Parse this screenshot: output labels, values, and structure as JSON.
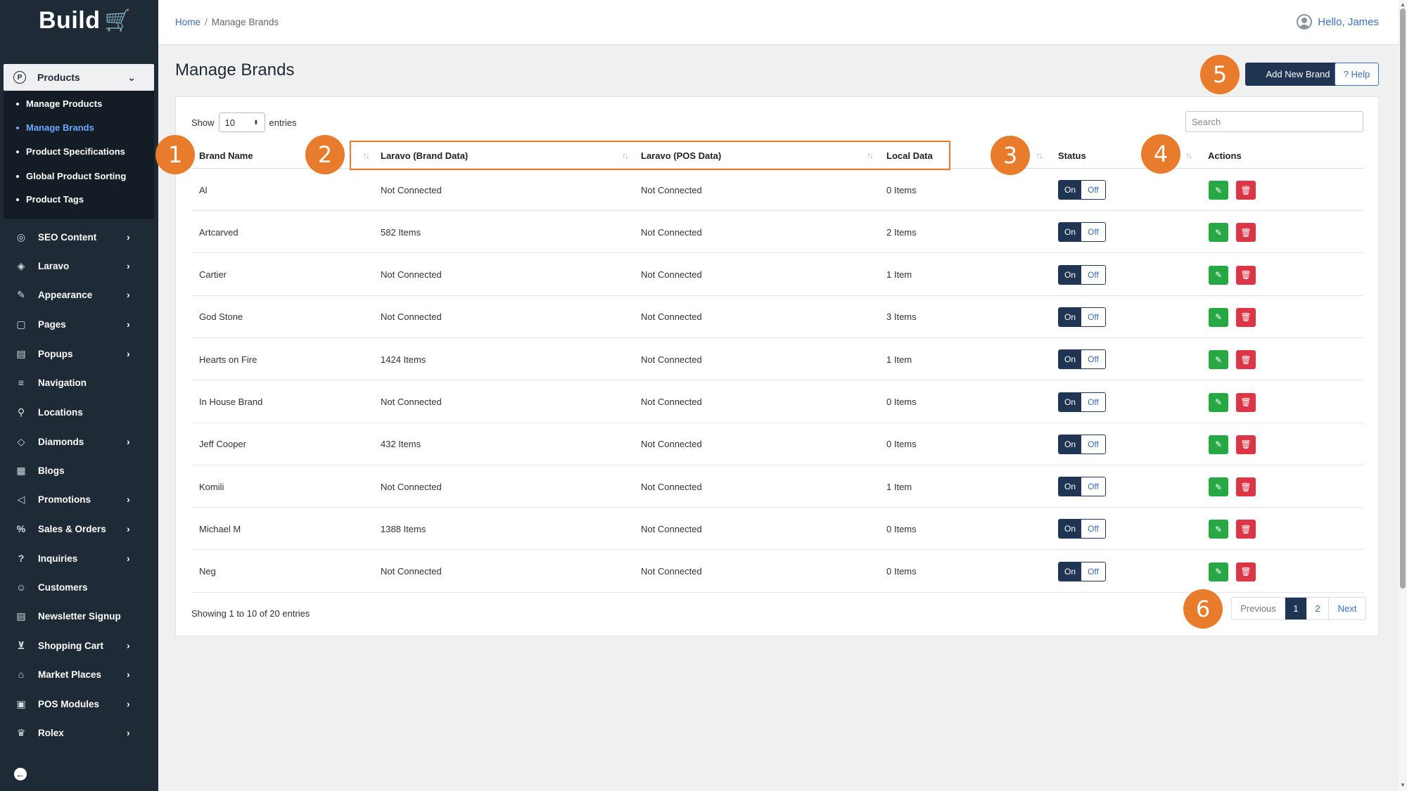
{
  "app": {
    "logo_text": "Build"
  },
  "sidebar": {
    "products": {
      "label": "Products",
      "subitems": [
        {
          "label": "Manage Products",
          "active": false
        },
        {
          "label": "Manage Brands",
          "active": true
        },
        {
          "label": "Product Specifications",
          "active": false
        },
        {
          "label": "Global Product Sorting",
          "active": false
        },
        {
          "label": "Product Tags",
          "active": false
        }
      ]
    },
    "items": [
      {
        "label": "SEO Content",
        "icon": "seo-icon",
        "chevron": true
      },
      {
        "label": "Laravo",
        "icon": "layers-icon",
        "chevron": true
      },
      {
        "label": "Appearance",
        "icon": "brush-icon",
        "chevron": true
      },
      {
        "label": "Pages",
        "icon": "page-icon",
        "chevron": true
      },
      {
        "label": "Popups",
        "icon": "popup-icon",
        "chevron": true
      },
      {
        "label": "Navigation",
        "icon": "menu-icon",
        "chevron": false
      },
      {
        "label": "Locations",
        "icon": "pin-icon",
        "chevron": false
      },
      {
        "label": "Diamonds",
        "icon": "diamond-icon",
        "chevron": true
      },
      {
        "label": "Blogs",
        "icon": "blog-icon",
        "chevron": false
      },
      {
        "label": "Promotions",
        "icon": "megaphone-icon",
        "chevron": true
      },
      {
        "label": "Sales & Orders",
        "icon": "percent-icon",
        "chevron": true
      },
      {
        "label": "Inquiries",
        "icon": "question-icon",
        "chevron": true
      },
      {
        "label": "Customers",
        "icon": "user-icon",
        "chevron": false
      },
      {
        "label": "Newsletter Signup",
        "icon": "newsletter-icon",
        "chevron": false
      },
      {
        "label": "Shopping Cart",
        "icon": "cart-icon",
        "chevron": true
      },
      {
        "label": "Market Places",
        "icon": "store-icon",
        "chevron": true
      },
      {
        "label": "POS Modules",
        "icon": "pos-icon",
        "chevron": true
      },
      {
        "label": "Rolex",
        "icon": "crown-icon",
        "chevron": true
      }
    ]
  },
  "topbar": {
    "breadcrumb_home": "Home",
    "breadcrumb_sep": "/",
    "breadcrumb_current": "Manage Brands",
    "greeting": "Hello, James"
  },
  "page": {
    "title": "Manage Brands",
    "add_button": "Add New Brand",
    "help_button": "? Help"
  },
  "table": {
    "show_label": "Show",
    "entries_value": "10",
    "entries_label": "entries",
    "search_placeholder": "Search",
    "columns": [
      "Brand Name",
      "Laravo (Brand Data)",
      "Laravo (POS Data)",
      "Local Data",
      "Status",
      "Actions"
    ],
    "toggle_on": "On",
    "toggle_off": "Off",
    "rows": [
      {
        "brand": "Al",
        "laravo_brand": "Not Connected",
        "laravo_pos": "Not Connected",
        "local": "0 Items"
      },
      {
        "brand": "Artcarved",
        "laravo_brand": "582 Items",
        "laravo_pos": "Not Connected",
        "local": "2 Items"
      },
      {
        "brand": "Cartier",
        "laravo_brand": "Not Connected",
        "laravo_pos": "Not Connected",
        "local": "1 Item"
      },
      {
        "brand": "God Stone",
        "laravo_brand": "Not Connected",
        "laravo_pos": "Not Connected",
        "local": "3 Items"
      },
      {
        "brand": "Hearts on Fire",
        "laravo_brand": "1424 Items",
        "laravo_pos": "Not Connected",
        "local": "1 Item"
      },
      {
        "brand": "In House Brand",
        "laravo_brand": "Not Connected",
        "laravo_pos": "Not Connected",
        "local": "0 Items"
      },
      {
        "brand": "Jeff Cooper",
        "laravo_brand": "432 Items",
        "laravo_pos": "Not Connected",
        "local": "0 Items"
      },
      {
        "brand": "Komili",
        "laravo_brand": "Not Connected",
        "laravo_pos": "Not Connected",
        "local": "1 Item"
      },
      {
        "brand": "Michael M",
        "laravo_brand": "1388 Items",
        "laravo_pos": "Not Connected",
        "local": "0 Items"
      },
      {
        "brand": "Neg",
        "laravo_brand": "Not Connected",
        "laravo_pos": "Not Connected",
        "local": "0 Items"
      }
    ],
    "showing_text": "Showing 1 to 10 of 20 entries",
    "pagination": {
      "previous": "Previous",
      "pages": [
        "1",
        "2"
      ],
      "current": "1",
      "next": "Next"
    }
  },
  "callouts": [
    "1",
    "2",
    "3",
    "4",
    "5",
    "6"
  ],
  "colors": {
    "sidebar_bg": "#1f2a37",
    "accent_navy": "#1f3553",
    "link_blue": "#3b6fb6",
    "callout_orange": "#e87b2c",
    "edit_green": "#28a745",
    "delete_red": "#dc3545"
  }
}
